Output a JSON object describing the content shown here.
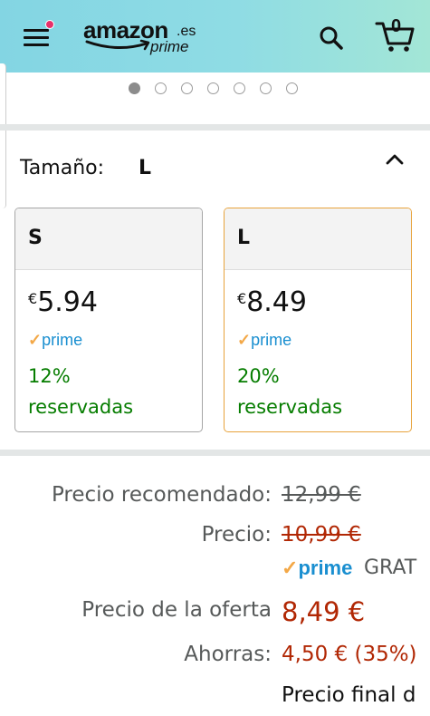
{
  "header": {
    "logo_text": "amazon",
    "logo_tld": ".es",
    "logo_sub": "prime",
    "cart_count": "0",
    "notification_color": "#e8306a"
  },
  "carousel": {
    "total": 7,
    "active": 0
  },
  "size": {
    "label": "Tamaño:",
    "selected": "L",
    "options": [
      {
        "name": "S",
        "currency": "€",
        "price": "5.94",
        "prime": "prime",
        "pct": "12%",
        "reserved": "reservadas",
        "selected": false
      },
      {
        "name": "L",
        "currency": "€",
        "price": "8.49",
        "prime": "prime",
        "pct": "20%",
        "reserved": "reservadas",
        "selected": true
      }
    ]
  },
  "pricing": {
    "recommended_label": "Precio recomendado:",
    "recommended_value": "12,99 €",
    "price_label": "Precio:",
    "price_value": "10,99 €",
    "prime_label": "prime",
    "shipping_text": "GRAT",
    "offer_label": "Precio de la oferta",
    "offer_value": "8,49 €",
    "savings_label": "Ahorras:",
    "savings_value": "4,50 € (35%)",
    "final_text": "Precio final d"
  },
  "colors": {
    "header_gradient_start": "#83d5e3",
    "header_gradient_end": "#a3e6d6",
    "prime_blue": "#1a8fd0",
    "prime_check": "#f3a847",
    "deal_green": "#067d00",
    "price_red": "#b12704",
    "selected_border": "#e8a33c"
  }
}
